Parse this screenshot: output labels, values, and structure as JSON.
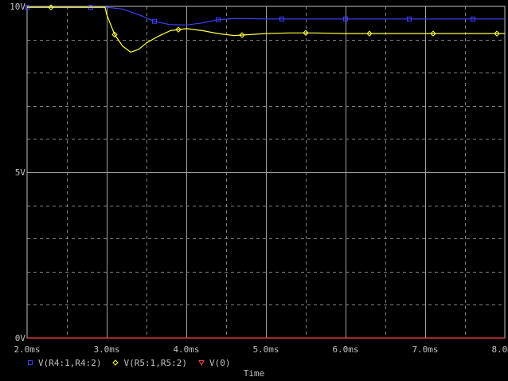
{
  "chart_data": {
    "type": "line",
    "title": "",
    "xlabel": "Time",
    "ylabel": "",
    "xlim": [
      2.0,
      8.0
    ],
    "ylim": [
      0,
      10
    ],
    "grid": true,
    "legend_position": "bottom-left",
    "x_ticks": [
      "2.0ms",
      "3.0ms",
      "4.0ms",
      "5.0ms",
      "6.0ms",
      "7.0ms",
      "8.0ms"
    ],
    "y_ticks": [
      "0V",
      "5V",
      "10V"
    ],
    "series": [
      {
        "name": "V(R4:1,R4:2)",
        "color": "#4040ff",
        "marker": "square",
        "x": [
          2.0,
          2.3,
          2.6,
          3.0,
          3.2,
          3.4,
          3.6,
          3.8,
          4.0,
          4.2,
          4.4,
          4.6,
          4.8,
          5.0,
          5.5,
          6.0,
          6.5,
          7.0,
          7.5,
          8.0
        ],
        "y": [
          9.97,
          9.97,
          9.97,
          9.97,
          9.92,
          9.75,
          9.55,
          9.45,
          9.44,
          9.5,
          9.6,
          9.63,
          9.63,
          9.62,
          9.62,
          9.62,
          9.62,
          9.62,
          9.62,
          9.62
        ]
      },
      {
        "name": "V(R5:1,R5:2)",
        "color": "#ffff40",
        "marker": "diamond",
        "x": [
          2.0,
          2.3,
          2.6,
          2.98,
          3.0,
          3.05,
          3.1,
          3.2,
          3.3,
          3.4,
          3.5,
          3.65,
          3.8,
          4.0,
          4.2,
          4.4,
          4.6,
          4.8,
          5.0,
          5.3,
          5.6,
          6.0,
          6.5,
          7.0,
          7.5,
          8.0
        ],
        "y": [
          9.97,
          9.97,
          9.97,
          9.97,
          9.75,
          9.45,
          9.15,
          8.8,
          8.62,
          8.7,
          8.9,
          9.1,
          9.27,
          9.33,
          9.27,
          9.18,
          9.12,
          9.15,
          9.18,
          9.2,
          9.2,
          9.18,
          9.18,
          9.18,
          9.18,
          9.18
        ]
      },
      {
        "name": "V(0)",
        "color": "#ff4040",
        "marker": "triangle",
        "x": [
          2.0,
          8.0
        ],
        "y": [
          0,
          0
        ]
      }
    ]
  }
}
